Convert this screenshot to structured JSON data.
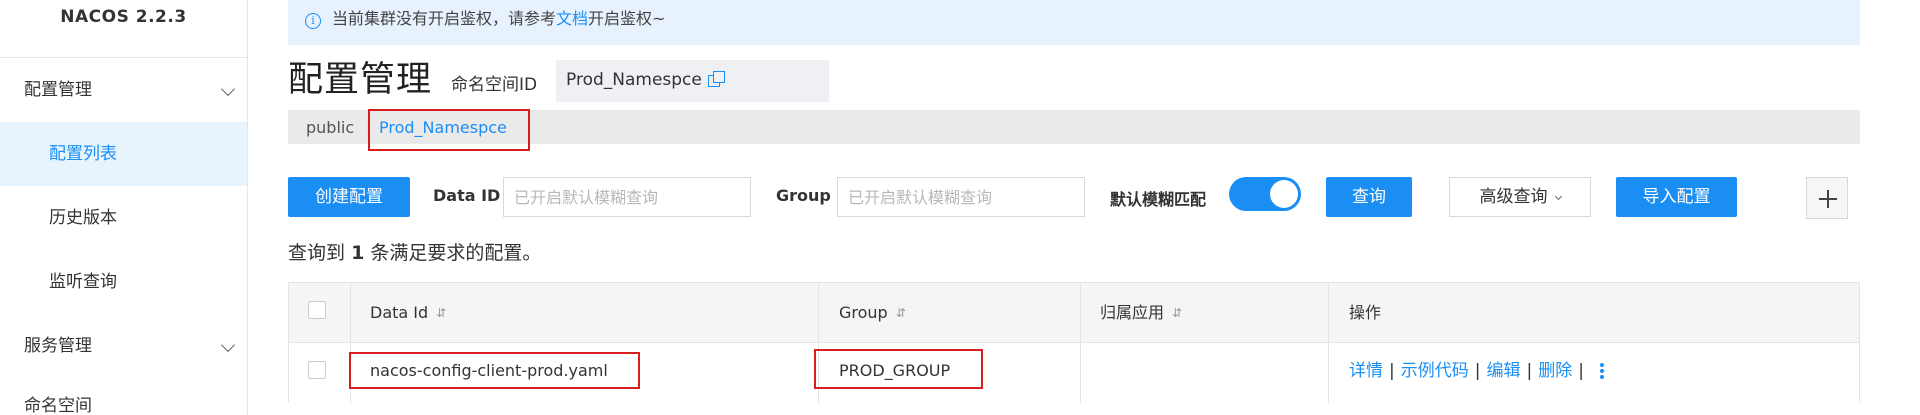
{
  "sidebar": {
    "brand": "NACOS 2.2.3",
    "groups": [
      {
        "label": "配置管理"
      },
      {
        "label": "服务管理"
      },
      {
        "label": "命名空间"
      }
    ],
    "items": [
      {
        "label": "配置列表",
        "active": true
      },
      {
        "label": "历史版本"
      },
      {
        "label": "监听查询"
      }
    ]
  },
  "banner": {
    "text_before": "当前集群没有开启鉴权，请参考",
    "link": "文档",
    "text_after": "开启鉴权~"
  },
  "header": {
    "title": "配置管理",
    "namespace_label": "命名空间ID",
    "namespace_value": "Prod_Namespce"
  },
  "namespace_tabs": {
    "items": [
      {
        "label": "public"
      },
      {
        "label": "Prod_Namespce",
        "active": true
      }
    ],
    "separator": "|"
  },
  "filters": {
    "create_button": "创建配置",
    "data_id_label": "Data ID",
    "data_id_placeholder": "已开启默认模糊查询",
    "group_label": "Group",
    "group_placeholder": "已开启默认模糊查询",
    "fuzzy_label": "默认模糊匹配",
    "fuzzy_enabled": true,
    "search_button": "查询",
    "advanced_button": "高级查询",
    "import_button": "导入配置"
  },
  "result": {
    "prefix": "查询到",
    "count": "1",
    "suffix": "条满足要求的配置。"
  },
  "table": {
    "columns": [
      "Data Id",
      "Group",
      "归属应用",
      "操作"
    ],
    "sort_icon": "⇵",
    "rows": [
      {
        "data_id": "nacos-config-client-prod.yaml",
        "group": "PROD_GROUP",
        "app": "",
        "actions": [
          "详情",
          "示例代码",
          "编辑",
          "删除"
        ]
      }
    ]
  },
  "colors": {
    "accent": "#1b8ef4",
    "highlight": "#d81e1e",
    "banner_bg": "#e7f2fe"
  }
}
